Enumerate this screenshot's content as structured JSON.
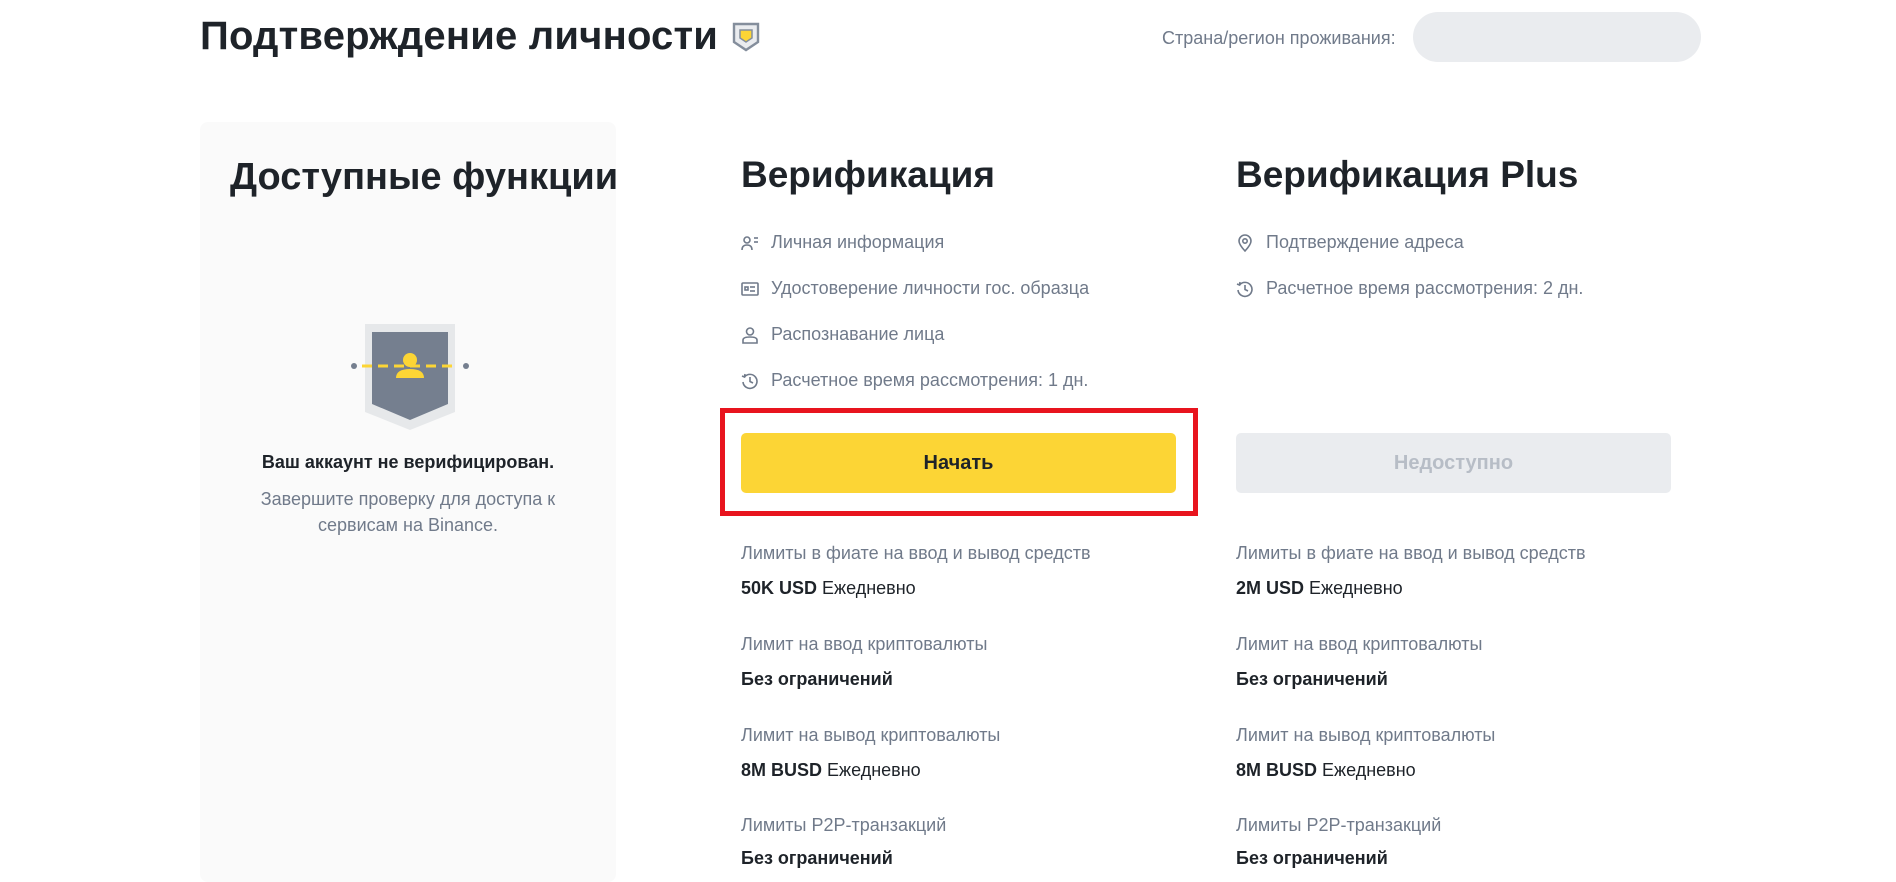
{
  "header": {
    "title": "Подтверждение личности",
    "country_label": "Страна/регион проживания:",
    "country_value": ""
  },
  "features": {
    "title": "Доступные функции",
    "status_title": "Ваш аккаунт не верифицирован.",
    "status_text": "Завершите проверку для доступа к сервисам на Binance."
  },
  "tiers": {
    "basic": {
      "title": "Верификация",
      "requirements": [
        {
          "icon": "personal-info-icon",
          "label": "Личная информация"
        },
        {
          "icon": "id-card-icon",
          "label": "Удостоверение личности гос. образца"
        },
        {
          "icon": "face-icon",
          "label": "Распознавание лица"
        },
        {
          "icon": "clock-icon",
          "label": "Расчетное время рассмотрения: 1 дн."
        }
      ],
      "button_label": "Начать",
      "limits": [
        {
          "label": "Лимиты в фиате на ввод и вывод средств",
          "value": "50K USD",
          "period": "Ежедневно"
        },
        {
          "label": "Лимит на ввод криптовалюты",
          "value": "Без ограничений",
          "period": ""
        },
        {
          "label": "Лимит на вывод криптовалюты",
          "value": "8M BUSD",
          "period": "Ежедневно"
        },
        {
          "label": "Лимиты P2P-транзакций",
          "value": "Без ограничений",
          "period": ""
        }
      ]
    },
    "plus": {
      "title": "Верификация Plus",
      "requirements": [
        {
          "icon": "location-icon",
          "label": "Подтверждение адреса"
        },
        {
          "icon": "clock-icon",
          "label": "Расчетное время рассмотрения: 2 дн."
        }
      ],
      "button_label": "Недоступно",
      "limits": [
        {
          "label": "Лимиты в фиате на ввод и вывод средств",
          "value": "2M USD",
          "period": "Ежедневно"
        },
        {
          "label": "Лимит на ввод криптовалюты",
          "value": "Без ограничений",
          "period": ""
        },
        {
          "label": "Лимит на вывод криптовалюты",
          "value": "8M BUSD",
          "period": "Ежедневно"
        },
        {
          "label": "Лимиты P2P-транзакций",
          "value": "Без ограничений",
          "period": ""
        }
      ]
    }
  },
  "colors": {
    "accent": "#fcd535",
    "text_primary": "#1e2329",
    "text_secondary": "#707a8a",
    "highlight": "#e8141e",
    "disabled_bg": "#eaecef"
  }
}
